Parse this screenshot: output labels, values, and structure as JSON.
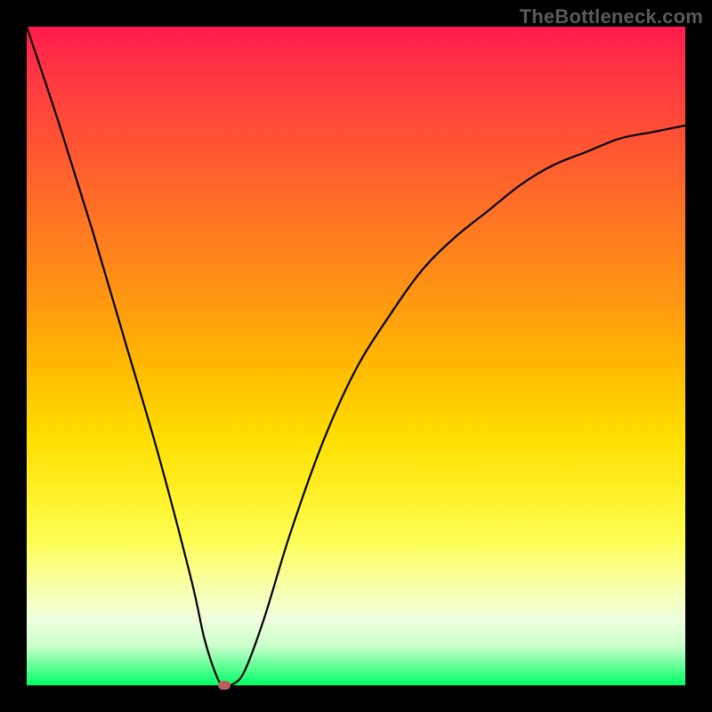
{
  "watermark": "TheBottleneck.com",
  "chart_data": {
    "type": "line",
    "title": "",
    "xlabel": "",
    "ylabel": "",
    "xlim": [
      0,
      100
    ],
    "ylim": [
      0,
      100
    ],
    "grid": false,
    "legend": false,
    "series": [
      {
        "name": "bottleneck-curve",
        "x": [
          0,
          5,
          10,
          15,
          20,
          25,
          27,
          29,
          30,
          31,
          33,
          36,
          40,
          45,
          50,
          55,
          60,
          65,
          70,
          75,
          80,
          85,
          90,
          95,
          100
        ],
        "y": [
          100,
          85,
          69,
          52,
          35,
          16,
          7,
          1,
          0,
          0,
          2,
          10,
          23,
          37,
          48,
          56,
          63,
          68,
          72,
          76,
          79,
          81,
          83,
          84,
          85
        ]
      }
    ],
    "annotations": [
      {
        "name": "optimal-marker",
        "x": 30,
        "y": 0
      }
    ],
    "background": "rainbow-gradient-vertical",
    "colors": {
      "curve": "#000000",
      "marker": "#bb5f58",
      "frame": "#000000"
    }
  }
}
